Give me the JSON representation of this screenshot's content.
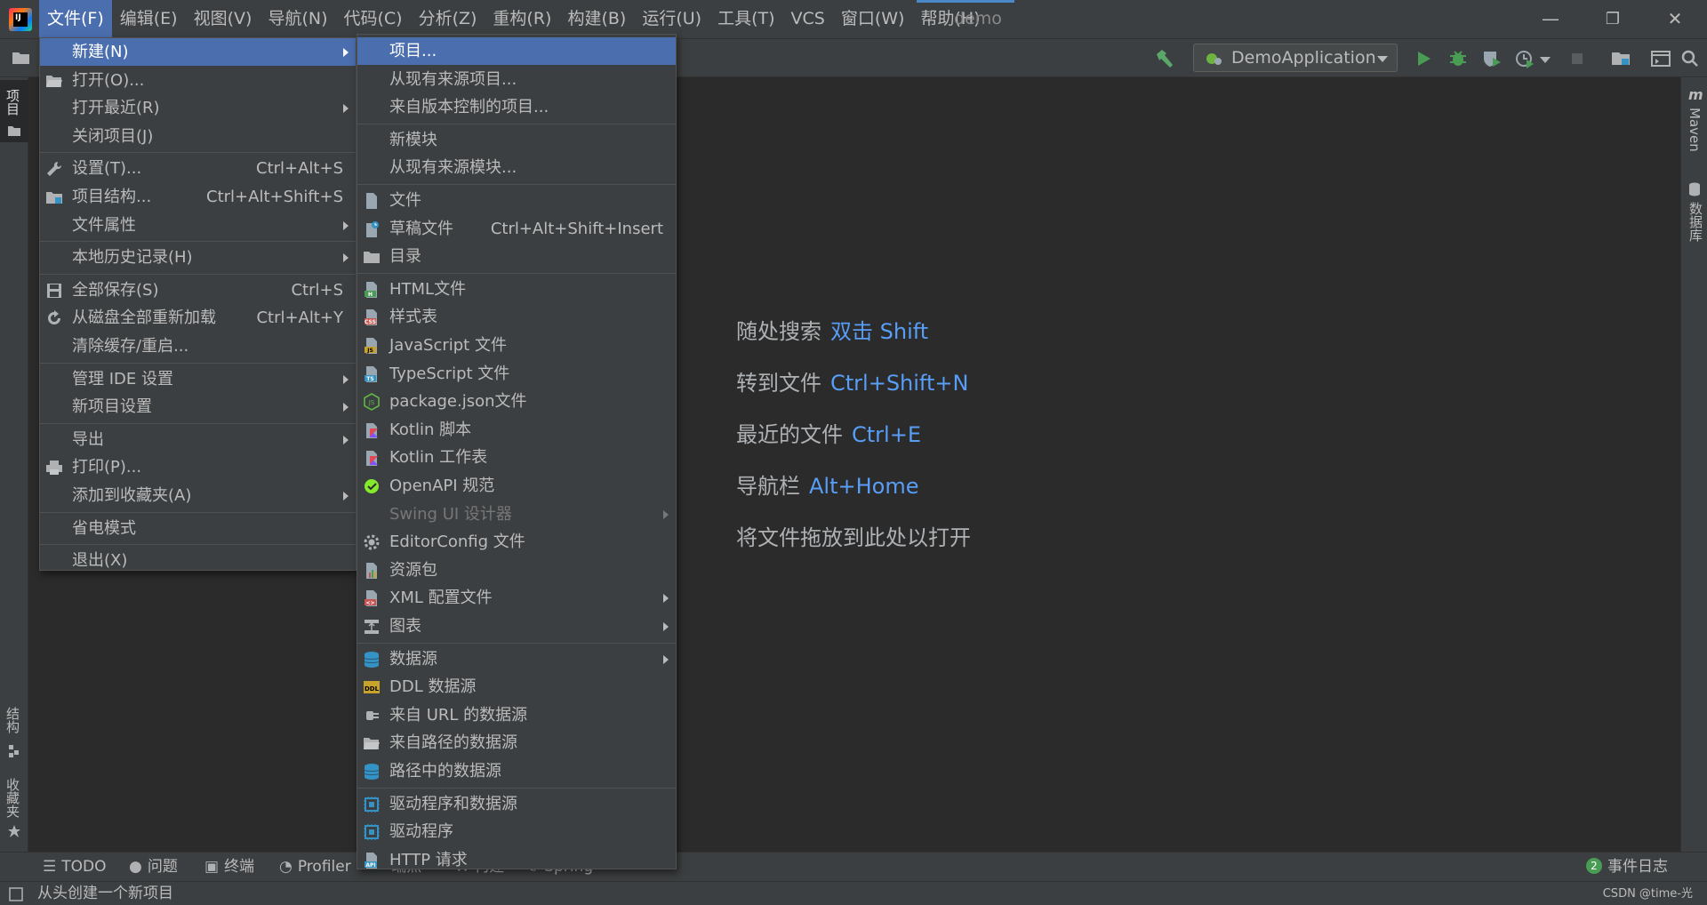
{
  "menubar": {
    "items": [
      "文件(F)",
      "编辑(E)",
      "视图(V)",
      "导航(N)",
      "代码(C)",
      "分析(Z)",
      "重构(R)",
      "构建(B)",
      "运行(U)",
      "工具(T)",
      "VCS",
      "窗口(W)",
      "帮助(H)"
    ],
    "active_index": 0,
    "project_name": "demo"
  },
  "window_controls": {
    "minimize": "—",
    "restore": "❐",
    "close": "✕"
  },
  "toolbar": {
    "run_config": "DemoApplication"
  },
  "file_menu": {
    "items": [
      {
        "label": "新建(N)",
        "shortcut": "",
        "submenu": true,
        "icon": "none",
        "selected": true
      },
      {
        "label": "打开(O)...",
        "shortcut": "",
        "submenu": false,
        "icon": "folder-open-icon"
      },
      {
        "label": "打开最近(R)",
        "shortcut": "",
        "submenu": true,
        "icon": "none"
      },
      {
        "label": "关闭项目(J)",
        "shortcut": "",
        "submenu": false,
        "icon": "none"
      },
      {
        "label": "设置(T)...",
        "shortcut": "Ctrl+Alt+S",
        "submenu": false,
        "icon": "wrench-icon"
      },
      {
        "label": "项目结构...",
        "shortcut": "Ctrl+Alt+Shift+S",
        "submenu": false,
        "icon": "project-structure-icon"
      },
      {
        "label": "文件属性",
        "shortcut": "",
        "submenu": true,
        "icon": "none"
      },
      {
        "label": "本地历史记录(H)",
        "shortcut": "",
        "submenu": true,
        "icon": "none"
      },
      {
        "label": "全部保存(S)",
        "shortcut": "Ctrl+S",
        "submenu": false,
        "icon": "save-icon"
      },
      {
        "label": "从磁盘全部重新加载",
        "shortcut": "Ctrl+Alt+Y",
        "submenu": false,
        "icon": "reload-icon"
      },
      {
        "label": "清除缓存/重启...",
        "shortcut": "",
        "submenu": false,
        "icon": "none"
      },
      {
        "label": "管理 IDE 设置",
        "shortcut": "",
        "submenu": true,
        "icon": "none"
      },
      {
        "label": "新项目设置",
        "shortcut": "",
        "submenu": true,
        "icon": "none"
      },
      {
        "label": "导出",
        "shortcut": "",
        "submenu": true,
        "icon": "none"
      },
      {
        "label": "打印(P)...",
        "shortcut": "",
        "submenu": false,
        "icon": "print-icon"
      },
      {
        "label": "添加到收藏夹(A)",
        "shortcut": "",
        "submenu": true,
        "icon": "none"
      },
      {
        "label": "省电模式",
        "shortcut": "",
        "submenu": false,
        "icon": "none"
      },
      {
        "label": "退出(X)",
        "shortcut": "",
        "submenu": false,
        "icon": "none"
      }
    ]
  },
  "new_submenu": {
    "items": [
      {
        "label": "项目...",
        "shortcut": "",
        "submenu": false,
        "icon": "none",
        "selected": true
      },
      {
        "label": "从现有来源项目...",
        "shortcut": "",
        "submenu": false,
        "icon": "none"
      },
      {
        "label": "来自版本控制的项目...",
        "shortcut": "",
        "submenu": false,
        "icon": "none"
      },
      {
        "label": "新模块",
        "shortcut": "",
        "submenu": false,
        "icon": "none"
      },
      {
        "label": "从现有来源模块...",
        "shortcut": "",
        "submenu": false,
        "icon": "none"
      },
      {
        "label": "文件",
        "shortcut": "",
        "submenu": false,
        "icon": "file-icon"
      },
      {
        "label": "草稿文件",
        "shortcut": "Ctrl+Alt+Shift+Insert",
        "submenu": false,
        "icon": "scratch-file-icon"
      },
      {
        "label": "目录",
        "shortcut": "",
        "submenu": false,
        "icon": "folder-icon"
      },
      {
        "label": "HTML文件",
        "shortcut": "",
        "submenu": false,
        "icon": "html-file-icon"
      },
      {
        "label": "样式表",
        "shortcut": "",
        "submenu": false,
        "icon": "css-file-icon"
      },
      {
        "label": "JavaScript 文件",
        "shortcut": "",
        "submenu": false,
        "icon": "js-file-icon"
      },
      {
        "label": "TypeScript 文件",
        "shortcut": "",
        "submenu": false,
        "icon": "ts-file-icon"
      },
      {
        "label": "package.json文件",
        "shortcut": "",
        "submenu": false,
        "icon": "nodejs-icon"
      },
      {
        "label": "Kotlin 脚本",
        "shortcut": "",
        "submenu": false,
        "icon": "kotlin-script-icon"
      },
      {
        "label": "Kotlin 工作表",
        "shortcut": "",
        "submenu": false,
        "icon": "kotlin-worksheet-icon"
      },
      {
        "label": "OpenAPI 规范",
        "shortcut": "",
        "submenu": false,
        "icon": "openapi-icon"
      },
      {
        "label": "Swing UI 设计器",
        "shortcut": "",
        "submenu": true,
        "icon": "none",
        "disabled": true
      },
      {
        "label": "EditorConfig 文件",
        "shortcut": "",
        "submenu": false,
        "icon": "gear-icon"
      },
      {
        "label": "资源包",
        "shortcut": "",
        "submenu": false,
        "icon": "resource-bundle-icon"
      },
      {
        "label": "XML 配置文件",
        "shortcut": "",
        "submenu": true,
        "icon": "xml-file-icon"
      },
      {
        "label": "图表",
        "shortcut": "",
        "submenu": true,
        "icon": "diagram-icon"
      },
      {
        "label": "数据源",
        "shortcut": "",
        "submenu": true,
        "icon": "database-icon"
      },
      {
        "label": "DDL 数据源",
        "shortcut": "",
        "submenu": false,
        "icon": "ddl-icon"
      },
      {
        "label": "来自 URL 的数据源",
        "shortcut": "",
        "submenu": false,
        "icon": "plug-icon"
      },
      {
        "label": "来自路径的数据源",
        "shortcut": "",
        "submenu": false,
        "icon": "folder-open-icon"
      },
      {
        "label": "路径中的数据源",
        "shortcut": "",
        "submenu": false,
        "icon": "database-icon"
      },
      {
        "label": "驱动程序和数据源",
        "shortcut": "",
        "submenu": false,
        "icon": "driver-icon"
      },
      {
        "label": "驱动程序",
        "shortcut": "",
        "submenu": false,
        "icon": "driver-icon"
      },
      {
        "label": "HTTP 请求",
        "shortcut": "",
        "submenu": false,
        "icon": "api-file-icon"
      }
    ]
  },
  "left_strip": {
    "project_tab": "项目",
    "structure_tab": "结构",
    "favorites_tab": "收藏夹"
  },
  "right_strip": {
    "maven_tab": "Maven",
    "database_tab": "数据库"
  },
  "editor_hints": [
    {
      "label": "随处搜索",
      "key": "双击 Shift"
    },
    {
      "label": "转到文件",
      "key": "Ctrl+Shift+N"
    },
    {
      "label": "最近的文件",
      "key": "Ctrl+E"
    },
    {
      "label": "导航栏",
      "key": "Alt+Home"
    },
    {
      "label": "将文件拖放到此处以打开",
      "key": ""
    }
  ],
  "bottom_tools": {
    "todo": "TODO",
    "problems": "问题",
    "terminal": "终端",
    "profiler": "Profiler",
    "endpoints": "端点",
    "build": "构建",
    "spring": "Spring",
    "event_log_count": "2",
    "event_log": "事件日志"
  },
  "statusbar": {
    "text": "从头创建一个新项目",
    "watermark": "CSDN @time-光"
  },
  "colors": {
    "accent": "#4b6eaf",
    "link": "#589df6",
    "background": "#2b2b2b",
    "panel": "#3c3f41",
    "run_green": "#499c54"
  }
}
